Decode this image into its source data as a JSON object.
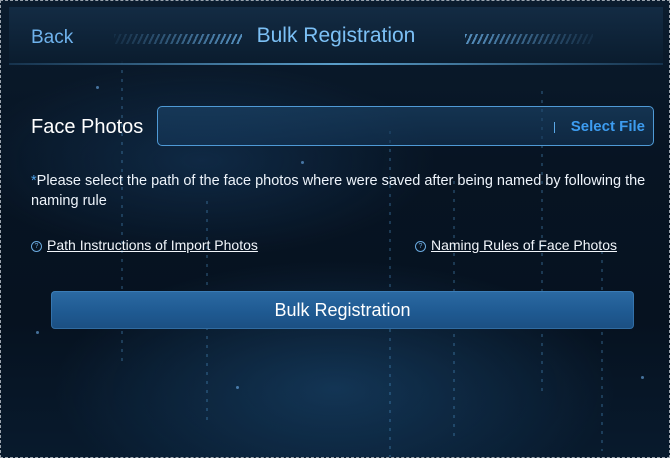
{
  "header": {
    "back_label": "Back",
    "title": "Bulk Registration"
  },
  "form": {
    "face_photos_label": "Face Photos",
    "file_path_value": "",
    "select_file_label": "Select File",
    "note_star": "*",
    "note_text": "Please select the path of the face photos where were saved after being named by following the naming rule"
  },
  "links": {
    "path_instructions": "Path Instructions of Import Photos",
    "naming_rules": "Naming Rules of Face Photos",
    "icon": "question-circle-icon",
    "icon_glyph": "?"
  },
  "actions": {
    "bulk_registration_label": "Bulk Registration"
  },
  "colors": {
    "accent": "#3d9cf0",
    "title": "#7cc0f5",
    "button": "#1f5a92",
    "background": "#071423"
  }
}
